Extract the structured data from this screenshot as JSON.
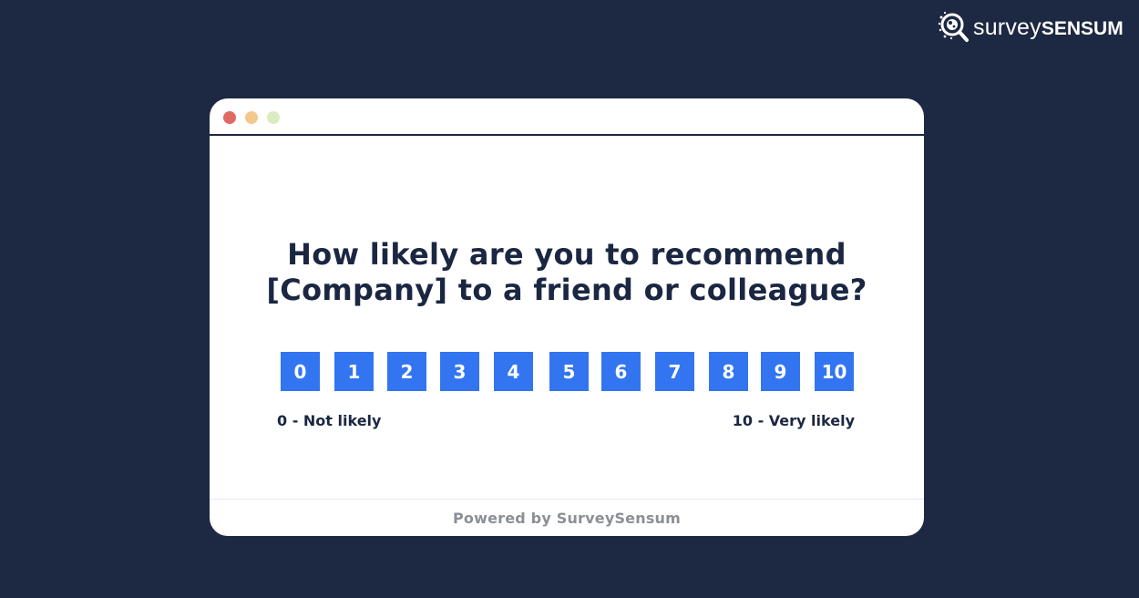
{
  "brand": {
    "icon": "magnifier-logo-icon",
    "survey_text": "survey",
    "sensum_text": "SENSUM"
  },
  "window": {
    "controls": [
      {
        "name": "close",
        "color": "#e06a63"
      },
      {
        "name": "minimize",
        "color": "#f2c98a"
      },
      {
        "name": "maximize",
        "color": "#dcecc0"
      }
    ]
  },
  "survey": {
    "question_line1": "How likely are you to recommend",
    "question_line2": "[Company] to a friend or colleague?",
    "scale": [
      "0",
      "1",
      "2",
      "3",
      "4",
      "5",
      "6",
      "7",
      "8",
      "9",
      "10"
    ],
    "low_label": "0 - Not likely",
    "high_label": "10 - Very likely"
  },
  "footer": {
    "text": "Powered by SurveySensum"
  },
  "colors": {
    "background": "#1d2842",
    "accent": "#3375f0",
    "question_text": "#1b2742",
    "footer_text": "#8b8f96"
  }
}
